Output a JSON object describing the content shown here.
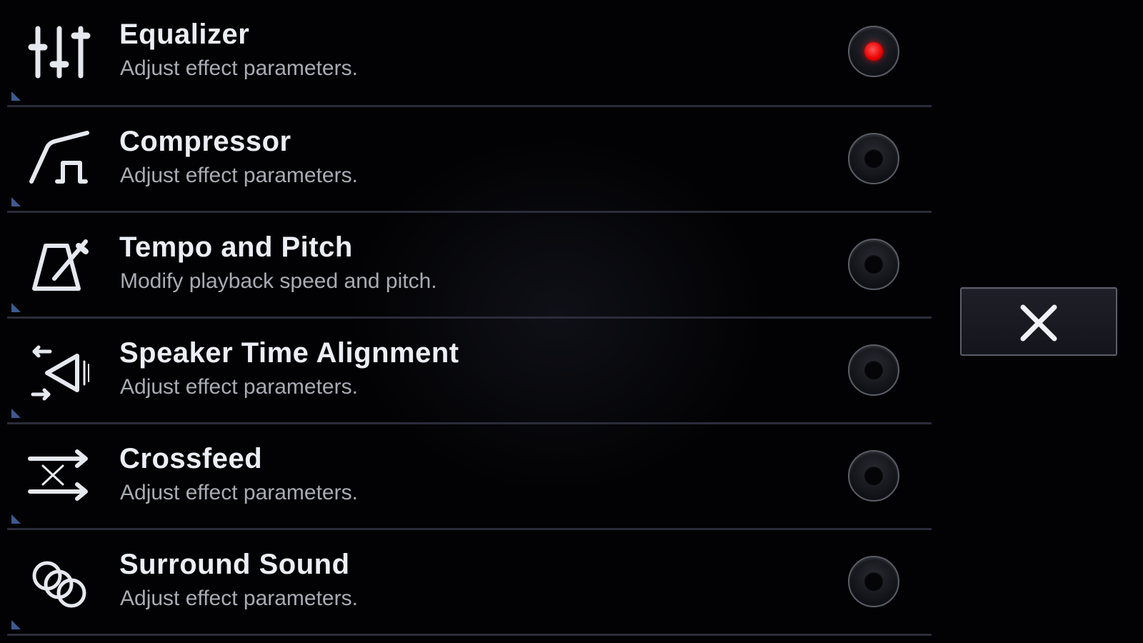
{
  "effects": [
    {
      "id": "equalizer",
      "name": "Equalizer",
      "description": "Adjust effect parameters.",
      "icon": "equalizer-sliders-icon",
      "enabled": true
    },
    {
      "id": "compressor",
      "name": "Compressor",
      "description": "Adjust effect parameters.",
      "icon": "compressor-curve-icon",
      "enabled": false
    },
    {
      "id": "tempo-pitch",
      "name": "Tempo and Pitch",
      "description": "Modify playback speed and pitch.",
      "icon": "metronome-icon",
      "enabled": false
    },
    {
      "id": "speaker-alignment",
      "name": "Speaker Time Alignment",
      "description": "Adjust effect parameters.",
      "icon": "speaker-arrows-icon",
      "enabled": false
    },
    {
      "id": "crossfeed",
      "name": "Crossfeed",
      "description": "Adjust effect parameters.",
      "icon": "crossfeed-arrows-icon",
      "enabled": false
    },
    {
      "id": "surround",
      "name": "Surround Sound",
      "description": "Adjust effect parameters.",
      "icon": "surround-circles-icon",
      "enabled": false
    }
  ],
  "colors": {
    "toggle_on": "#e80000",
    "toggle_off": "#050507",
    "title_text": "#eceef6",
    "description_text": "#a9abb4",
    "divider": "#2b2c3a"
  },
  "close_button": {
    "icon": "close-icon"
  }
}
